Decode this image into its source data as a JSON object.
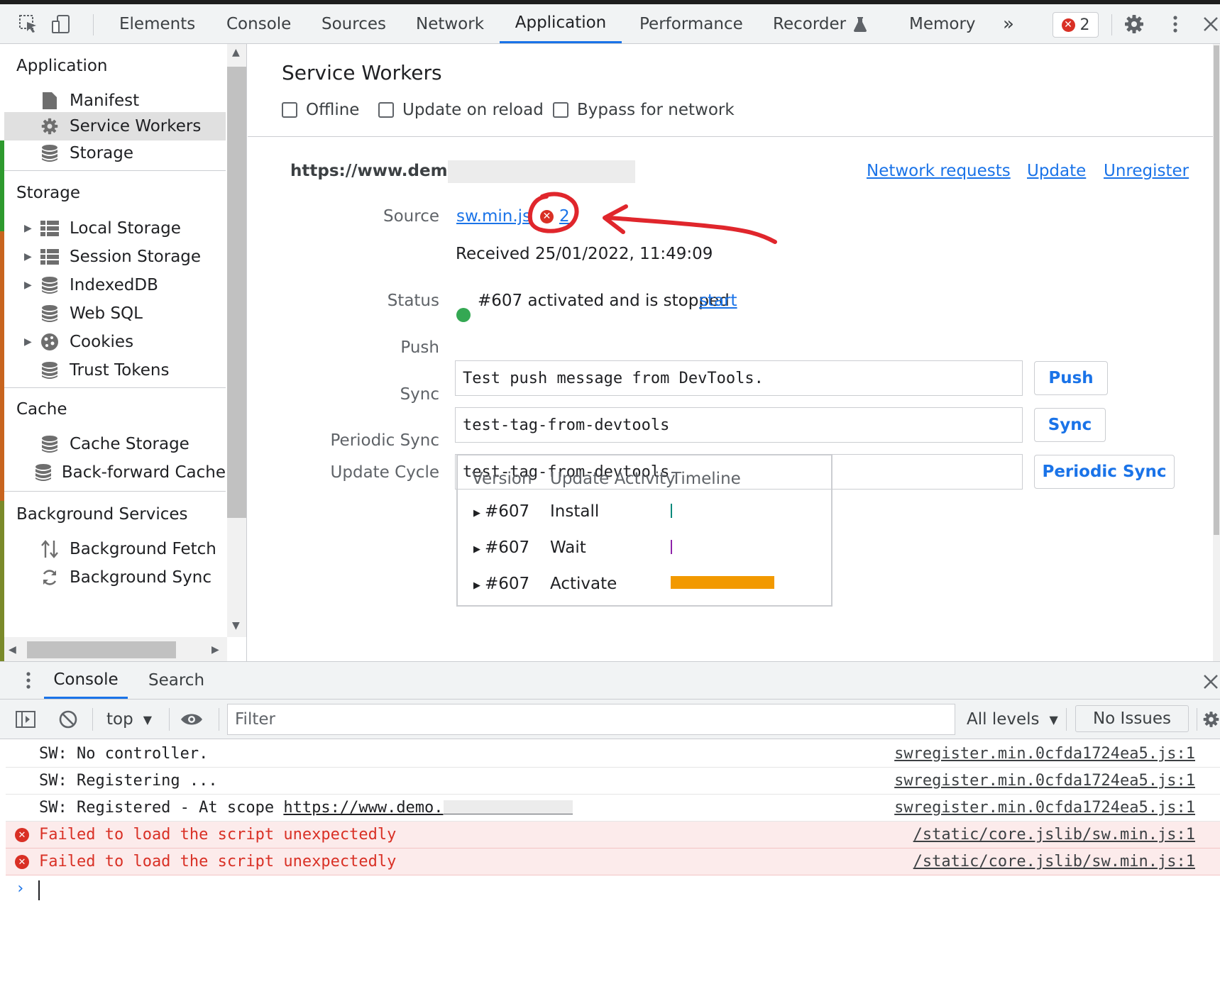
{
  "toolbar": {
    "tabs": [
      {
        "label": "Elements"
      },
      {
        "label": "Console"
      },
      {
        "label": "Sources"
      },
      {
        "label": "Network"
      },
      {
        "label": "Application"
      },
      {
        "label": "Performance"
      },
      {
        "label": "Recorder"
      },
      {
        "label": "Memory"
      }
    ],
    "active_tab": "Application",
    "more_tabs": "»",
    "error_count": "2",
    "icons": [
      "inspect-element-icon",
      "device-toolbar-icon",
      "recorder-flask-icon",
      "more-tabs-icon",
      "error-icon",
      "gear-icon",
      "kebab-menu-icon",
      "close-icon"
    ]
  },
  "sidebar": {
    "sections": [
      {
        "title": "Application",
        "items": [
          {
            "label": "Manifest",
            "icon": "document-icon"
          },
          {
            "label": "Service Workers",
            "icon": "gear-icon",
            "selected": true
          },
          {
            "label": "Storage",
            "icon": "database-icon"
          }
        ]
      },
      {
        "title": "Storage",
        "items": [
          {
            "label": "Local Storage",
            "icon": "table-icon",
            "expandable": true
          },
          {
            "label": "Session Storage",
            "icon": "table-icon",
            "expandable": true
          },
          {
            "label": "IndexedDB",
            "icon": "database-icon",
            "expandable": true
          },
          {
            "label": "Web SQL",
            "icon": "database-icon"
          },
          {
            "label": "Cookies",
            "icon": "cookie-icon",
            "expandable": true
          },
          {
            "label": "Trust Tokens",
            "icon": "database-icon"
          }
        ]
      },
      {
        "title": "Cache",
        "items": [
          {
            "label": "Cache Storage",
            "icon": "database-icon"
          },
          {
            "label": "Back-forward Cache",
            "icon": "database-icon"
          }
        ]
      },
      {
        "title": "Background Services",
        "items": [
          {
            "label": "Background Fetch",
            "icon": "up-down-arrows-icon"
          },
          {
            "label": "Background Sync",
            "icon": "sync-icon"
          }
        ]
      }
    ]
  },
  "main": {
    "title": "Service Workers",
    "checkboxes": [
      {
        "label": "Offline",
        "checked": false
      },
      {
        "label": "Update on reload",
        "checked": false
      },
      {
        "label": "Bypass for network",
        "checked": false
      }
    ],
    "origin": "https://www.demo.",
    "actions": [
      "Network requests",
      "Update",
      "Unregister"
    ],
    "source": {
      "label": "Source",
      "file": "sw.min.js",
      "error_count": "2",
      "received": "Received 25/01/2022, 11:49:09"
    },
    "status": {
      "label": "Status",
      "text": "#607 activated and is stopped",
      "action": "start",
      "dot_color": "#34a853"
    },
    "push": {
      "label": "Push",
      "value": "Test push message from DevTools.",
      "button": "Push"
    },
    "sync": {
      "label": "Sync",
      "value": "test-tag-from-devtools",
      "button": "Sync"
    },
    "periodic_sync": {
      "label": "Periodic Sync",
      "value": "test-tag-from-devtools",
      "button": "Periodic Sync"
    },
    "update_cycle": {
      "label": "Update Cycle",
      "headers": [
        "Version",
        "Update Activity",
        "Timeline"
      ],
      "rows": [
        {
          "version": "#607",
          "activity": "Install",
          "timeline_color": "#00897b"
        },
        {
          "version": "#607",
          "activity": "Wait",
          "timeline_color": "#8e24aa"
        },
        {
          "version": "#607",
          "activity": "Activate",
          "timeline_color": "#f29900"
        }
      ]
    }
  },
  "drawer": {
    "tabs": [
      "Console",
      "Search"
    ],
    "active_tab": "Console",
    "toolbar": {
      "context": "top",
      "filter_placeholder": "Filter",
      "levels": "All levels",
      "issues": "No Issues"
    },
    "messages": [
      {
        "level": "info",
        "text": "SW: No controller.",
        "source": "swregister.min.0cfda1724ea5.js:1"
      },
      {
        "level": "info",
        "text": "SW: Registering ...",
        "source": "swregister.min.0cfda1724ea5.js:1"
      },
      {
        "level": "info",
        "text": "SW: Registered - At scope ",
        "link": "https://www.demo.",
        "source": "swregister.min.0cfda1724ea5.js:1"
      },
      {
        "level": "error",
        "text": "Failed to load the script unexpectedly",
        "source": "/static/core.jslib/sw.min.js:1"
      },
      {
        "level": "error",
        "text": "Failed to load the script unexpectedly",
        "source": "/static/core.jslib/sw.min.js:1"
      }
    ],
    "prompt": "›"
  },
  "colors": {
    "accent": "#1a73e8",
    "error": "#d93025",
    "error_bg": "#fcebeb",
    "annotation": "#e0262c"
  }
}
